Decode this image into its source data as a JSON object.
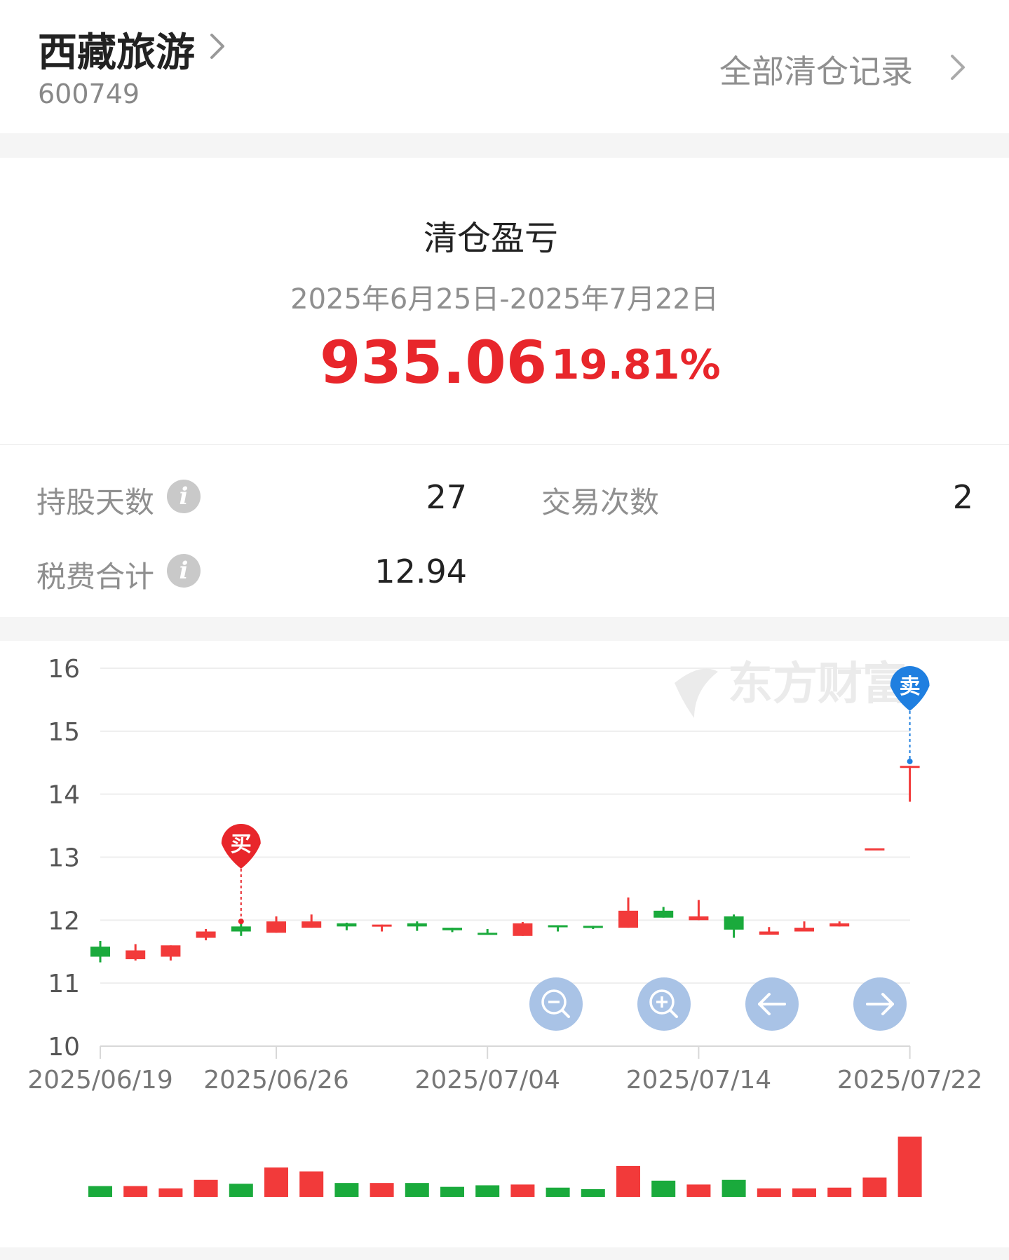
{
  "header": {
    "stock_name": "西藏旅游",
    "stock_code": "600749",
    "all_records_link": "全部清仓记录"
  },
  "summary": {
    "title": "清仓盈亏",
    "period": "2025年6月25日-2025年7月22日",
    "profit_amount": "935.06",
    "profit_rate": "19.81%"
  },
  "stats": {
    "holding_days_label": "持股天数",
    "holding_days_value": "27",
    "trade_count_label": "交易次数",
    "trade_count_value": "2",
    "fees_label": "税费合计",
    "fees_value": "12.94"
  },
  "icons": {
    "info": "i"
  },
  "watermark": "东方财富",
  "colors": {
    "up": "#f23a3a",
    "down": "#1aaa3c",
    "buy_marker": "#e8262b",
    "sell_marker": "#1f7fe0",
    "control_button": "#a9c3e6"
  },
  "chart_data": {
    "type": "candlestick",
    "ylim": [
      10,
      16
    ],
    "y_ticks": [
      "16",
      "15",
      "14",
      "13",
      "12",
      "11",
      "10"
    ],
    "x_ticks": [
      {
        "label": "2025/06/19",
        "index": 0
      },
      {
        "label": "2025/06/26",
        "index": 5
      },
      {
        "label": "2025/07/04",
        "index": 11
      },
      {
        "label": "2025/07/14",
        "index": 17
      },
      {
        "label": "2025/07/22",
        "index": 23
      }
    ],
    "candles": [
      {
        "open": 11.58,
        "close": 11.42,
        "high": 11.67,
        "low": 11.33,
        "volume": 14
      },
      {
        "open": 11.38,
        "close": 11.52,
        "high": 11.62,
        "low": 11.36,
        "volume": 14
      },
      {
        "open": 11.42,
        "close": 11.6,
        "high": 11.6,
        "low": 11.36,
        "volume": 11
      },
      {
        "open": 11.72,
        "close": 11.82,
        "high": 11.86,
        "low": 11.68,
        "volume": 22
      },
      {
        "open": 11.9,
        "close": 11.82,
        "high": 11.96,
        "low": 11.75,
        "volume": 17
      },
      {
        "open": 11.8,
        "close": 11.98,
        "high": 12.06,
        "low": 11.8,
        "volume": 38
      },
      {
        "open": 11.88,
        "close": 11.98,
        "high": 12.09,
        "low": 11.88,
        "volume": 33
      },
      {
        "open": 11.95,
        "close": 11.9,
        "high": 11.96,
        "low": 11.84,
        "volume": 18
      },
      {
        "open": 11.9,
        "close": 11.93,
        "high": 11.93,
        "low": 11.82,
        "volume": 18
      },
      {
        "open": 11.95,
        "close": 11.9,
        "high": 11.98,
        "low": 11.83,
        "volume": 18
      },
      {
        "open": 11.88,
        "close": 11.84,
        "high": 11.88,
        "low": 11.81,
        "volume": 13
      },
      {
        "open": 11.8,
        "close": 11.77,
        "high": 11.86,
        "low": 11.77,
        "volume": 15
      },
      {
        "open": 11.75,
        "close": 11.95,
        "high": 11.97,
        "low": 11.75,
        "volume": 16
      },
      {
        "open": 11.92,
        "close": 11.9,
        "high": 11.92,
        "low": 11.82,
        "volume": 12
      },
      {
        "open": 11.91,
        "close": 11.89,
        "high": 11.91,
        "low": 11.86,
        "volume": 10
      },
      {
        "open": 11.88,
        "close": 12.15,
        "high": 12.36,
        "low": 11.88,
        "volume": 40
      },
      {
        "open": 12.15,
        "close": 12.04,
        "high": 12.21,
        "low": 12.04,
        "volume": 21
      },
      {
        "open": 12.0,
        "close": 12.06,
        "high": 12.32,
        "low": 12.0,
        "volume": 16
      },
      {
        "open": 12.06,
        "close": 11.85,
        "high": 12.09,
        "low": 11.72,
        "volume": 22
      },
      {
        "open": 11.77,
        "close": 11.82,
        "high": 11.89,
        "low": 11.77,
        "volume": 11
      },
      {
        "open": 11.82,
        "close": 11.88,
        "high": 11.98,
        "low": 11.82,
        "volume": 11
      },
      {
        "open": 11.9,
        "close": 11.95,
        "high": 11.98,
        "low": 11.9,
        "volume": 12
      },
      {
        "open": 13.14,
        "close": 13.14,
        "high": 13.14,
        "low": 13.14,
        "volume": 25
      },
      {
        "open": 14.45,
        "close": 14.45,
        "high": 14.45,
        "low": 13.88,
        "volume": 78
      }
    ],
    "markers": [
      {
        "label": "买",
        "index": 4,
        "price": 11.98,
        "side": "buy"
      },
      {
        "label": "卖",
        "index": 23,
        "price": 14.52,
        "side": "sell"
      }
    ],
    "controls": [
      "zoom-out",
      "zoom-in",
      "scroll-left",
      "scroll-right"
    ]
  }
}
